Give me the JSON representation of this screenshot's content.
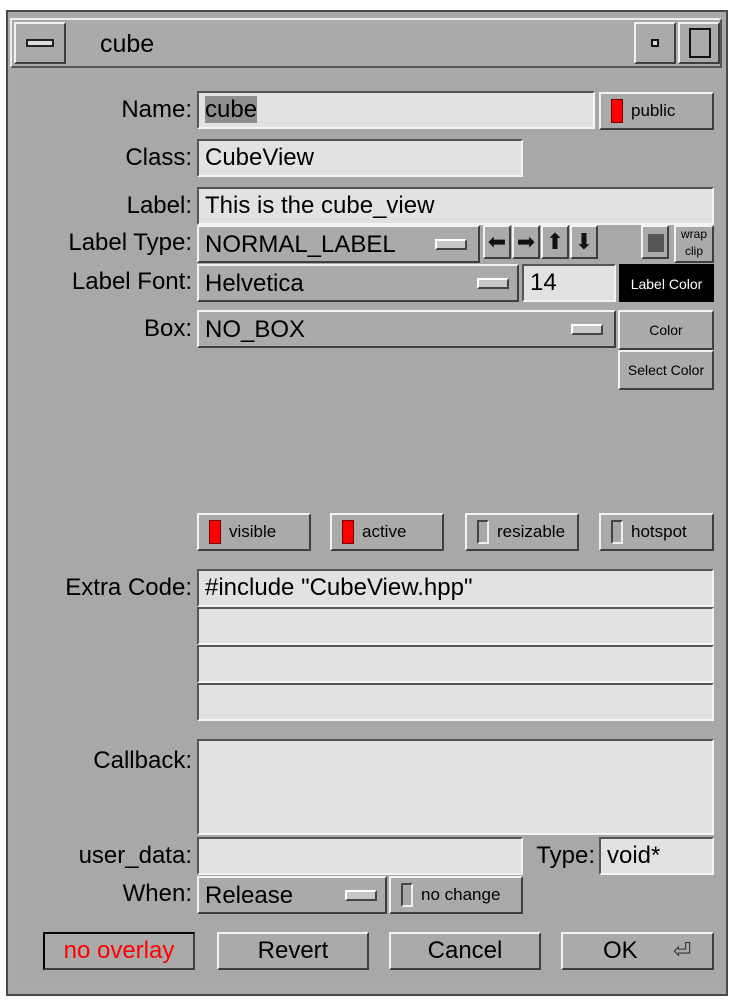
{
  "window": {
    "title": "cube"
  },
  "form": {
    "name": {
      "label": "Name:",
      "value": "cube"
    },
    "public_label": "public",
    "class": {
      "label": "Class:",
      "value": "CubeView"
    },
    "label_text": {
      "label": "Label:",
      "value": "This is the cube_view"
    },
    "label_type": {
      "label": "Label Type:",
      "value": "NORMAL_LABEL"
    },
    "align": {
      "wrap": "wrap",
      "clip": "clip"
    },
    "label_font": {
      "label": "Label Font:",
      "value": "Helvetica",
      "size": "14"
    },
    "label_color_button": "Label Color",
    "box": {
      "label": "Box:",
      "value": "NO_BOX"
    },
    "color_button": "Color",
    "select_color_button": "Select Color",
    "flags": {
      "visible": "visible",
      "active": "active",
      "resizable": "resizable",
      "hotspot": "hotspot"
    },
    "extra_code": {
      "label": "Extra Code:",
      "lines": [
        "#include \"CubeView.hpp\"",
        "",
        "",
        ""
      ]
    },
    "callback": {
      "label": "Callback:",
      "value": ""
    },
    "user_data": {
      "label": "user_data:",
      "value": ""
    },
    "type": {
      "label": "Type:",
      "value": "void*"
    },
    "when": {
      "label": "When:",
      "value": "Release"
    },
    "no_change_label": "no change"
  },
  "buttons": {
    "no_overlay": "no overlay",
    "revert": "Revert",
    "cancel": "Cancel",
    "ok": "OK"
  },
  "colors": {
    "indicator_on": "#ff0000",
    "no_overlay_text": "#ff0000",
    "field_bg": "#e2e2e2",
    "panel_bg": "#aaaaaa"
  }
}
